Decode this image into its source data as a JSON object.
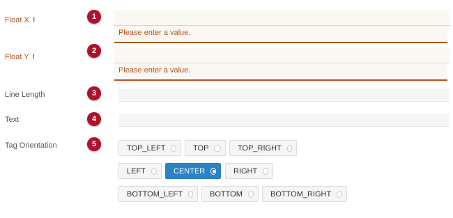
{
  "fields": {
    "float_x": {
      "label": "Float X",
      "required_mark": "!",
      "badge": "1",
      "value": "",
      "error": "Please enter a value."
    },
    "float_y": {
      "label": "Float Y",
      "required_mark": "!",
      "badge": "2",
      "value": "",
      "error": "Please enter a value."
    },
    "line_length": {
      "label": "Line Length",
      "badge": "3",
      "value": ""
    },
    "text": {
      "label": "Text",
      "badge": "4",
      "value": ""
    },
    "tag_orientation": {
      "label": "Tag Orientation",
      "badge": "5",
      "selected": "CENTER",
      "options": [
        "TOP_LEFT",
        "TOP",
        "TOP_RIGHT",
        "LEFT",
        "CENTER",
        "RIGHT",
        "BOTTOM_LEFT",
        "BOTTOM",
        "BOTTOM_RIGHT"
      ]
    }
  },
  "colors": {
    "error": "#b5521c",
    "badge": "#b0102a",
    "selected": "#2b82c4"
  }
}
